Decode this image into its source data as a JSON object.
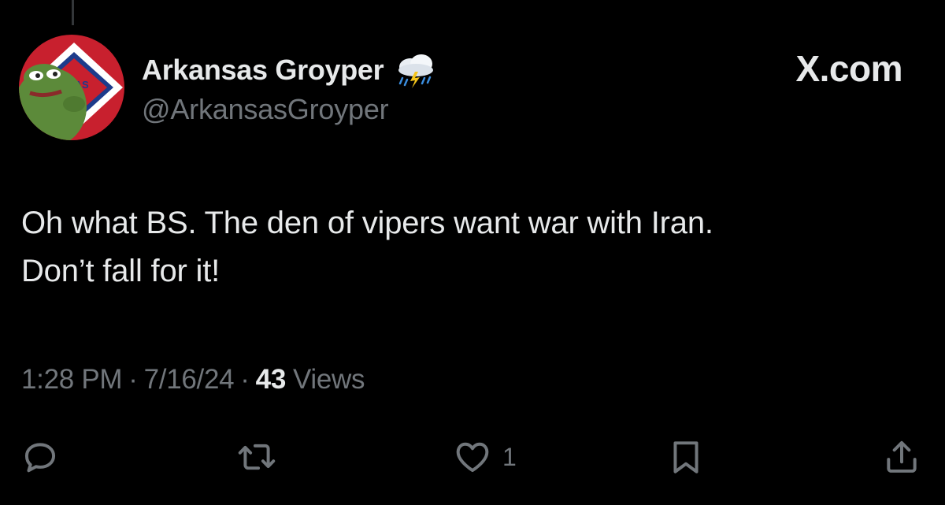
{
  "tweet": {
    "author": {
      "display_name": "Arkansas Groyper",
      "name_emoji_icon": "cloud-with-lightning-and-rain-icon",
      "handle": "@ArkansasGroyper",
      "avatar_flag_text": "SAS"
    },
    "brand": "X.com",
    "text_lines": [
      "Oh what BS. The den of vipers want war with Iran.",
      "Don’t fall for it!"
    ],
    "time": "1:28 PM",
    "separator": "·",
    "date": "7/16/24",
    "views_count": "43",
    "views_label": "Views"
  },
  "actions": {
    "reply": {
      "icon": "reply-icon",
      "count": ""
    },
    "repost": {
      "icon": "repost-icon",
      "count": ""
    },
    "like": {
      "icon": "heart-icon",
      "count": "1"
    },
    "bookmark": {
      "icon": "bookmark-icon",
      "count": ""
    },
    "share": {
      "icon": "share-icon",
      "count": ""
    }
  },
  "colors": {
    "background": "#000000",
    "primary_text": "#e7e9ea",
    "secondary_text": "#71767b"
  }
}
